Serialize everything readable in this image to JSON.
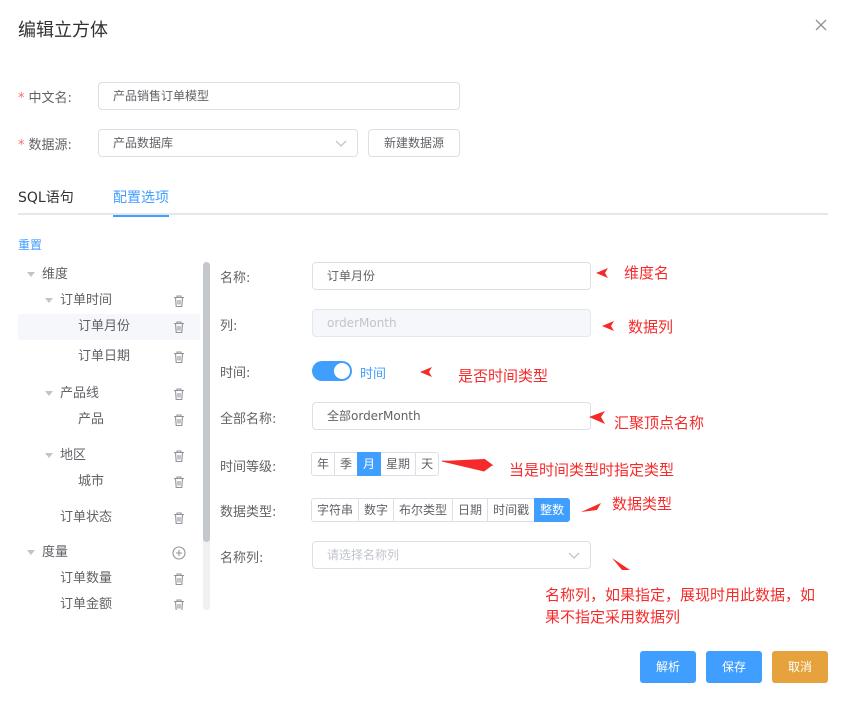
{
  "dialog": {
    "title": "编辑立方体"
  },
  "form": {
    "cn_name": {
      "label": "中文名:",
      "value": "产品销售订单模型"
    },
    "datasource": {
      "label": "数据源:",
      "value": "产品数据库",
      "new_button": "新建数据源"
    }
  },
  "tabs": [
    {
      "label": "SQL语句"
    },
    {
      "label": "配置选项"
    }
  ],
  "reset_label": "重置",
  "tree": [
    {
      "label": "维度",
      "level": 0,
      "expandable": true,
      "action": ""
    },
    {
      "label": "订单时间",
      "level": 1,
      "expandable": true,
      "action": "delete"
    },
    {
      "label": "订单月份",
      "level": 2,
      "expandable": false,
      "action": "delete",
      "selected": true
    },
    {
      "label": "订单日期",
      "level": 2,
      "expandable": false,
      "action": "delete"
    },
    {
      "label": "产品线",
      "level": 1,
      "expandable": true,
      "action": "delete"
    },
    {
      "label": "产品",
      "level": 2,
      "expandable": false,
      "action": "delete"
    },
    {
      "label": "地区",
      "level": 1,
      "expandable": true,
      "action": "delete"
    },
    {
      "label": "城市",
      "level": 2,
      "expandable": false,
      "action": "delete"
    },
    {
      "label": "订单状态",
      "level": 1,
      "expandable": false,
      "action": "delete"
    },
    {
      "label": "度量",
      "level": 0,
      "expandable": true,
      "action": "add"
    },
    {
      "label": "订单数量",
      "level": 1,
      "expandable": false,
      "action": "delete"
    },
    {
      "label": "订单金额",
      "level": 1,
      "expandable": false,
      "action": "delete"
    }
  ],
  "detail": {
    "name": {
      "label": "名称:",
      "value": "订单月份"
    },
    "column": {
      "label": "列:",
      "value": "orderMonth"
    },
    "time": {
      "label": "时间:",
      "switch_label": "时间",
      "on": true
    },
    "full_name": {
      "label": "全部名称:",
      "value": "全部orderMonth"
    },
    "time_level": {
      "label": "时间等级:",
      "options": [
        "年",
        "季",
        "月",
        "星期",
        "天"
      ],
      "selected": "月"
    },
    "data_type": {
      "label": "数据类型:",
      "options": [
        "字符串",
        "数字",
        "布尔类型",
        "日期",
        "时间戳",
        "整数"
      ],
      "selected": "整数"
    },
    "name_column": {
      "label": "名称列:",
      "placeholder": "请选择名称列"
    }
  },
  "annotations": {
    "name": "维度名",
    "column": "数据列",
    "time": "是否时间类型",
    "full_name": "汇聚顶点名称",
    "time_level": "当是时间类型时指定类型",
    "data_type": "数据类型",
    "name_column_line1": "名称列，如果指定，展现时用此数据，如",
    "name_column_line2": "果不指定采用数据列"
  },
  "buttons": {
    "parse": "解析",
    "save": "保存",
    "cancel": "取消"
  },
  "colors": {
    "primary": "#409eff",
    "warning": "#e6a23c",
    "annotation": "#f52b2b"
  }
}
